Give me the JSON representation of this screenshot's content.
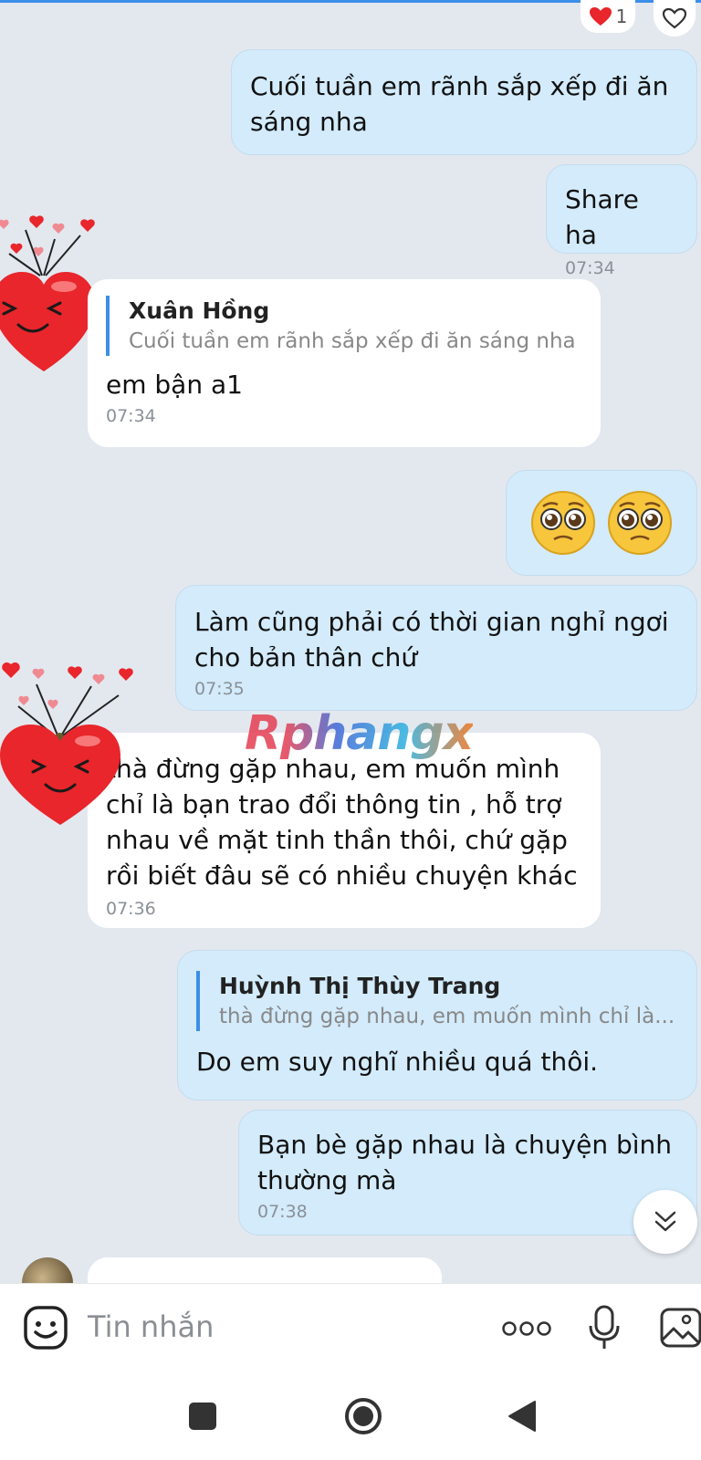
{
  "reactions": {
    "heart_count": "1"
  },
  "messages": [
    {
      "id": "m1",
      "side": "mine",
      "text": "Cuối tuần em rãnh sắp xếp đi ăn\nsáng nha"
    },
    {
      "id": "m2",
      "side": "mine",
      "text": "Share ha",
      "time": "07:34"
    },
    {
      "id": "m3",
      "side": "theirs",
      "quote": {
        "name": "Xuân Hồng",
        "text": "Cuối tuần em rãnh sắp xếp đi ăn sáng nha"
      },
      "text": "em bận a1",
      "time": "07:34"
    },
    {
      "id": "m4",
      "side": "mine",
      "emoji": "🥺🥺"
    },
    {
      "id": "m5",
      "side": "mine",
      "text": "Làm cũng phải có thời gian nghỉ ngơi\ncho bản thân chứ",
      "time": "07:35"
    },
    {
      "id": "m6",
      "side": "theirs",
      "text": "thà đừng gặp nhau, em muốn mình\nchỉ là bạn trao đổi thông tin , hỗ trợ\nnhau về mặt tinh thần thôi, chứ gặp\nrồi biết đâu sẽ có nhiều chuyện khác",
      "time": "07:36"
    },
    {
      "id": "m7",
      "side": "mine",
      "quote": {
        "name": "Huỳnh Thị Thùy Trang",
        "text": "thà đừng gặp nhau, em muốn mình chỉ là..."
      },
      "text": "Do em suy nghĩ nhiều quá thôi."
    },
    {
      "id": "m8",
      "side": "mine",
      "text": "Bạn bè gặp nhau là chuyện bình\nthường mà",
      "time": "07:38"
    }
  ],
  "watermark": "Rphangx",
  "input": {
    "placeholder": "Tin nhắn"
  },
  "icons": {
    "sticker": "sticker-icon",
    "more": "more-options-icon",
    "mic": "microphone-icon",
    "image": "image-icon",
    "scroll_down": "chevron-double-down-icon",
    "nav_recent": "square-icon",
    "nav_home": "circle-icon",
    "nav_back": "back-triangle-icon"
  },
  "colors": {
    "background": "#e3e8ef",
    "my_bubble": "#d3ebfb",
    "their_bubble": "#ffffff",
    "accent": "#3b8fe8",
    "heart": "#e8262b"
  }
}
